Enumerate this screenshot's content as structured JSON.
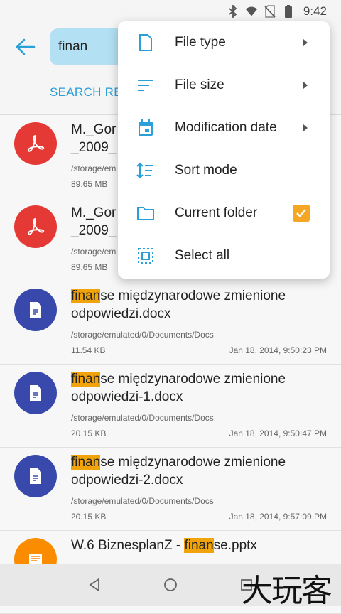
{
  "status": {
    "time": "9:42",
    "icons": [
      "bluetooth-icon",
      "wifi-icon",
      "no-sim-icon",
      "battery-icon"
    ]
  },
  "header": {
    "search_value": "finan",
    "tab": "SEARCH RESULTS"
  },
  "menu": {
    "items": [
      {
        "label": "File type",
        "icon": "file-icon",
        "submenu": true
      },
      {
        "label": "File size",
        "icon": "file-size-icon",
        "submenu": true
      },
      {
        "label": "Modification date",
        "icon": "calendar-icon",
        "submenu": true
      },
      {
        "label": "Sort mode",
        "icon": "sort-icon",
        "submenu": false
      },
      {
        "label": "Current folder",
        "icon": "folder-icon",
        "checked": true
      },
      {
        "label": "Select all",
        "icon": "select-all-icon",
        "submenu": false
      }
    ]
  },
  "files": [
    {
      "name_line1": "M._Gor",
      "name_line2": "_2009_",
      "path": "/storage/em",
      "size": "89.65 MB",
      "date": "",
      "type": "pdf",
      "color": "#e53935"
    },
    {
      "name_line1": "M._Gor",
      "name_line2": "_2009_",
      "path": "/storage/em",
      "size": "89.65 MB",
      "date": "",
      "type": "pdf",
      "color": "#e53935"
    },
    {
      "hl": "finan",
      "rest": "se międzynarodowe zmienione",
      "name_line2": "odpowiedzi.docx",
      "path": "/storage/emulated/0/Documents/Docs",
      "size": "11.54 KB",
      "date": "Jan 18, 2014, 9:50:23 PM",
      "type": "doc",
      "color": "#3949ab"
    },
    {
      "hl": "finan",
      "rest": "se międzynarodowe zmienione",
      "name_line2": "odpowiedzi-1.docx",
      "path": "/storage/emulated/0/Documents/Docs",
      "size": "20.15 KB",
      "date": "Jan 18, 2014, 9:50:47 PM",
      "type": "doc",
      "color": "#3949ab"
    },
    {
      "hl": "finan",
      "rest": "se międzynarodowe zmienione",
      "name_line2": "odpowiedzi-2.docx",
      "path": "/storage/emulated/0/Documents/Docs",
      "size": "20.15 KB",
      "date": "Jan 18, 2014, 9:57:09 PM",
      "type": "doc",
      "color": "#3949ab"
    },
    {
      "pre": "W.6 BiznesplanZ - ",
      "hl": "finan",
      "rest": "se.pptx",
      "type": "ppt",
      "color": "#fb8c00"
    }
  ],
  "watermark": "大玩客",
  "colors": {
    "accent": "#2a9fd8",
    "highlight": "#f0a30a",
    "check": "#f5a623"
  }
}
